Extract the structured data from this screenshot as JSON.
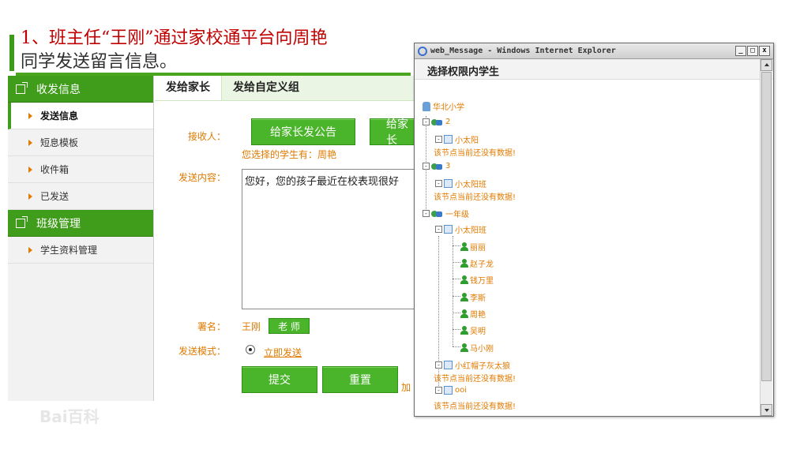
{
  "caption": {
    "line1": "1、班主任“王刚”通过家校通平台向周艳",
    "line2": "同学发送留言信息。"
  },
  "sidebar": {
    "section1": "收发信息",
    "items1": [
      "发送信息",
      "短息模板",
      "收件箱",
      "已发送"
    ],
    "section2": "班级管理",
    "items2": [
      "学生资料管理"
    ]
  },
  "tabs": [
    "发给家长",
    "发给自定义组"
  ],
  "form": {
    "recipient_label": "接收人：",
    "btn_notice": "给家长发公告",
    "btn_partial": "给家长",
    "selected_hint": "您选择的学生有：周艳",
    "content_label": "发送内容：",
    "content_value": "您好，您的孩子最近在校表现很好",
    "sign_label": "署名：",
    "sign_name": "王刚",
    "sign_badge": "老 师",
    "mode_label": "发送模式：",
    "mode_value": "立即发送",
    "submit": "提交",
    "reset": "重置",
    "extra": "加"
  },
  "window": {
    "title": "web_Message - Windows Internet Explorer",
    "ctrl_min": "_",
    "ctrl_max": "□",
    "ctrl_close": "x",
    "header": "选择权限内学生",
    "tree": {
      "school": "华北小学",
      "grade2": "2",
      "class_2": "小太阳",
      "empty_msg": "该节点当前还没有数据!",
      "grade3": "3",
      "class_3": "小太阳班",
      "grade1": "一年级",
      "class_1": "小太阳班",
      "students": [
        "丽丽",
        "赵子龙",
        "钱万里",
        "李斯",
        "周艳",
        "吴明",
        "马小刚"
      ],
      "class_red": "小红帽子灰太狼",
      "class_ooi": "ooi",
      "expander_open": "-"
    }
  },
  "watermark": "Bai百科"
}
